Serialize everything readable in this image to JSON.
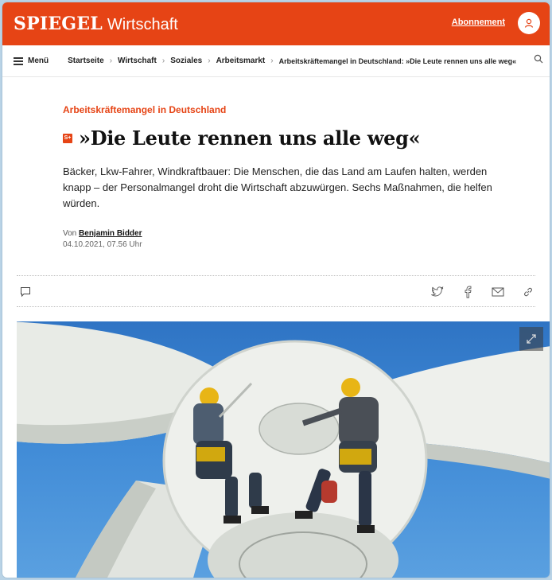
{
  "header": {
    "logo_main": "SPIEGEL",
    "logo_sub": "Wirtschaft",
    "subscription_label": "Abonnement",
    "user_icon": "user-icon",
    "accent_color": "#e64415"
  },
  "nav": {
    "menu_label": "Menü",
    "breadcrumbs": [
      "Startseite",
      "Wirtschaft",
      "Soziales",
      "Arbeitsmarkt",
      "Arbeitskräftemangel in Deutschland: »Die Leute rennen uns alle weg«"
    ],
    "search_icon": "search-icon"
  },
  "article": {
    "kicker": "Arbeitskräftemangel in Deutschland",
    "badge": "S+",
    "title": "»Die Leute rennen uns alle weg«",
    "lead": "Bäcker, Lkw-Fahrer, Windkraftbauer: Die Menschen, die das Land am Laufen halten, werden knapp – der Personalmangel droht die Wirtschaft abzuwürgen. Sechs Maßnahmen, die helfen würden.",
    "by_prefix": "Von",
    "author": "Benjamin Bidder",
    "date": "04.10.2021, 07.56 Uhr"
  },
  "share": {
    "icons": [
      "comment-icon",
      "twitter-icon",
      "facebook-icon",
      "mail-icon",
      "link-icon"
    ]
  },
  "hero": {
    "icon": "expand-icon"
  }
}
